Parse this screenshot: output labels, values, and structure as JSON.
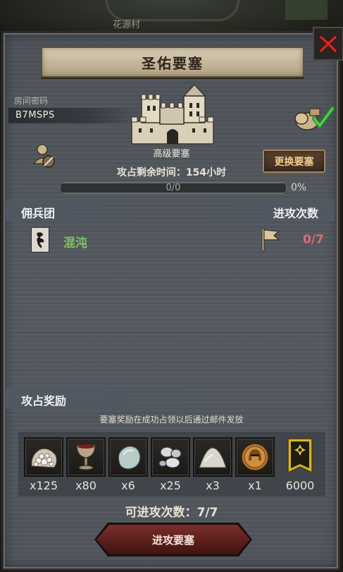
{
  "map": {
    "place_label": "花源村"
  },
  "header": {
    "title": "圣佑要塞"
  },
  "room": {
    "label": "房间密码",
    "code": "B7MSPS"
  },
  "fortress": {
    "name": "高级要塞",
    "change_label": "更换要塞",
    "time_label": "攻占剩余时间：",
    "time_value": "154小时",
    "progress_text": "0/0",
    "progress_percent": "0%",
    "progress_fraction": 0
  },
  "sections": {
    "mercenary": "佣兵团",
    "attacks": "进攻次数",
    "rewards": "攻占奖励"
  },
  "mercenaries": [
    {
      "name": "混沌",
      "attack_used": "0",
      "attack_total": "7"
    }
  ],
  "reward_note": "要塞奖励在成功占领以后通过邮件发放",
  "rewards": [
    {
      "icon": "ore-pile-icon",
      "qty": "x125"
    },
    {
      "icon": "goblet-icon",
      "qty": "x80"
    },
    {
      "icon": "stone-icon",
      "qty": "x6"
    },
    {
      "icon": "silver-pebbles-icon",
      "qty": "x25"
    },
    {
      "icon": "powder-pile-icon",
      "qty": "x3"
    },
    {
      "icon": "helmet-coin-icon",
      "qty": "x1"
    },
    {
      "icon": "guild-banner-icon",
      "qty": "6000"
    }
  ],
  "remaining": {
    "label": "可进攻次数：",
    "value": "7/7"
  },
  "attack_button": "进攻要塞",
  "colors": {
    "accent_green": "#7cc55e",
    "attack_red": "#d86e6e",
    "button_gold": "#f2c98a"
  }
}
